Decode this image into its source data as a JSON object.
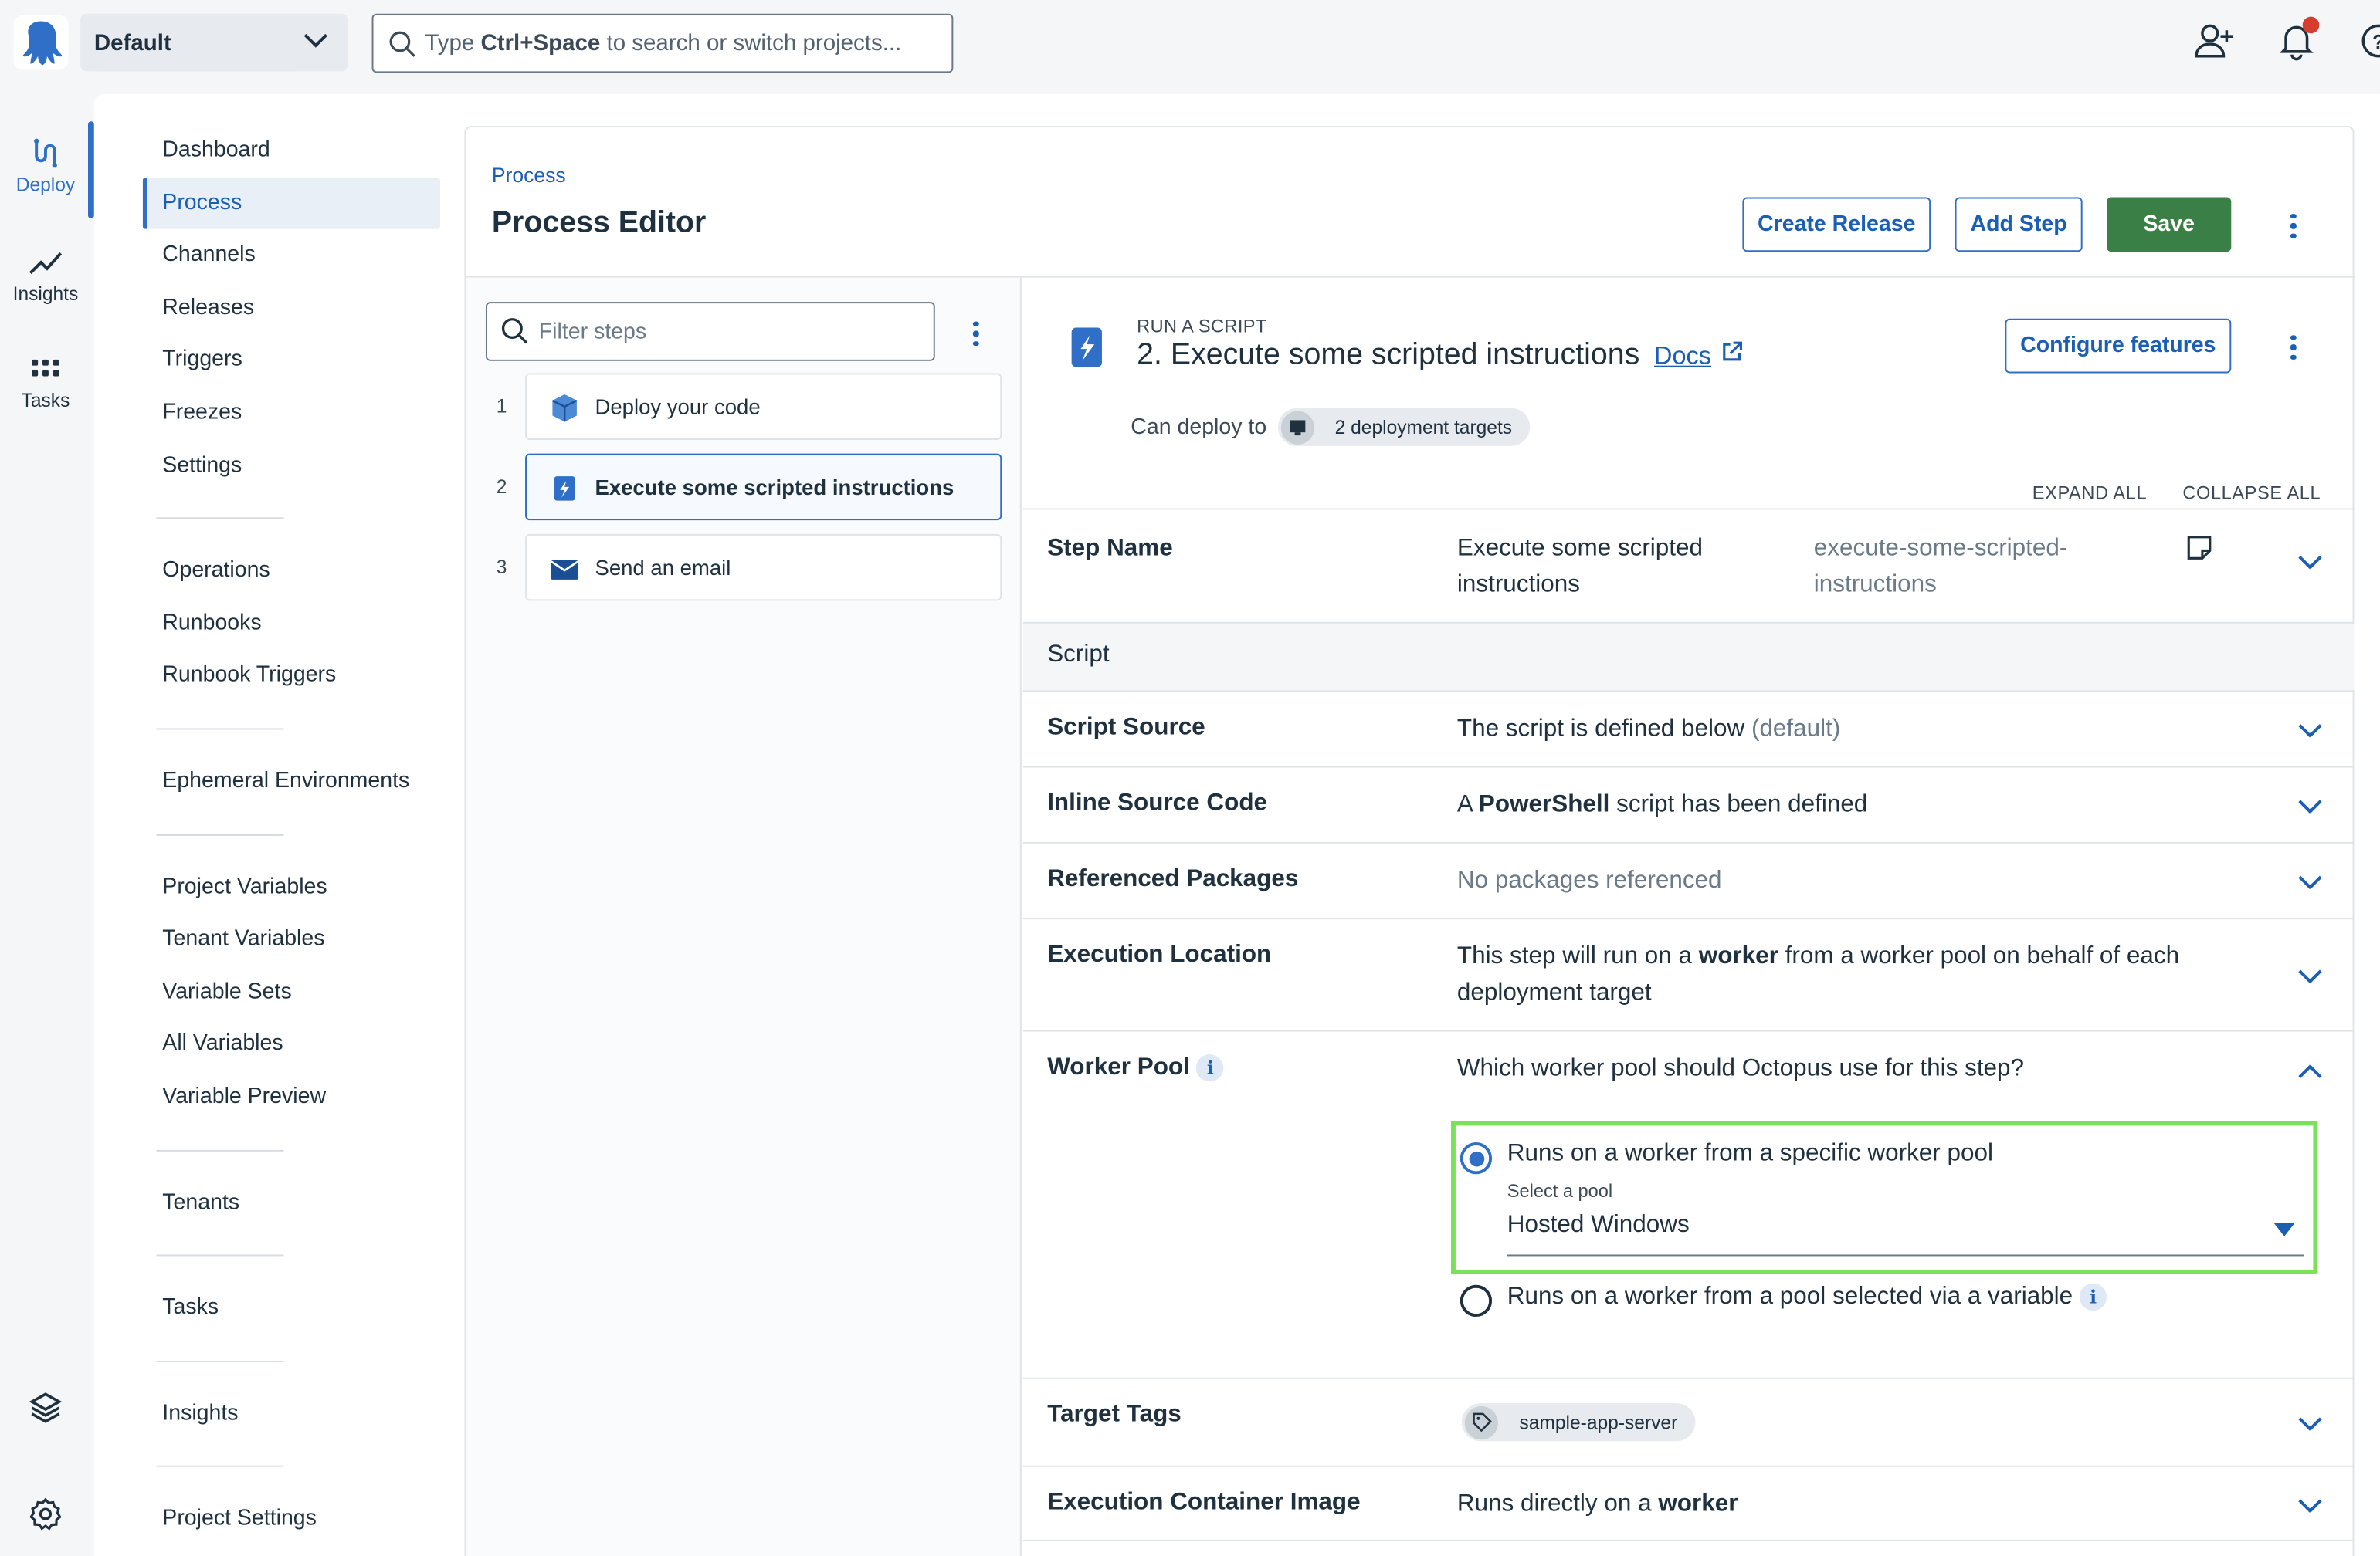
{
  "header": {
    "project": "Default",
    "search_prefix": "Type ",
    "search_shortcut": "Ctrl+Space",
    "search_suffix": " to search or switch projects..."
  },
  "rail": {
    "items": [
      {
        "label": "Deploy",
        "icon": "deploy-icon"
      },
      {
        "label": "Insights",
        "icon": "insights-icon"
      },
      {
        "label": "Tasks",
        "icon": "tasks-icon"
      }
    ]
  },
  "project_nav": {
    "groups": [
      [
        "Dashboard",
        "Process",
        "Channels",
        "Releases",
        "Triggers",
        "Freezes",
        "Settings"
      ],
      [
        "Operations",
        "Runbooks",
        "Runbook Triggers"
      ],
      [
        "Ephemeral Environments"
      ],
      [
        "Project Variables",
        "Tenant Variables",
        "Variable Sets",
        "All Variables",
        "Variable Preview"
      ],
      [
        "Tenants"
      ],
      [
        "Tasks"
      ],
      [
        "Insights"
      ],
      [
        "Project Settings"
      ]
    ],
    "active": "Process"
  },
  "page": {
    "breadcrumb": "Process",
    "title": "Process Editor",
    "create_release": "Create Release",
    "add_step": "Add Step",
    "save": "Save"
  },
  "steps": {
    "filter_placeholder": "Filter steps",
    "items": [
      {
        "num": "1",
        "label": "Deploy your code",
        "icon": "package-icon"
      },
      {
        "num": "2",
        "label": "Execute some scripted instructions",
        "icon": "script-icon"
      },
      {
        "num": "3",
        "label": "Send an email",
        "icon": "email-icon"
      }
    ]
  },
  "detail": {
    "type": "RUN A SCRIPT",
    "title": "2.  Execute some scripted instructions",
    "docs": "Docs",
    "configure": "Configure features",
    "can_deploy": "Can deploy to",
    "targets_chip": "2 deployment targets",
    "expand_all": "EXPAND ALL",
    "collapse_all": "COLLAPSE ALL",
    "step_name_label": "Step Name",
    "step_name_value": "Execute some scripted instructions",
    "step_slug": "execute-some-scripted-instructions",
    "script_section": "Script",
    "script_source_label": "Script Source",
    "script_source_value": "The script is defined below",
    "script_source_default": "(default)",
    "inline_label": "Inline Source Code",
    "inline_pre": "A ",
    "inline_bold": "PowerShell",
    "inline_post": " script has been defined",
    "packages_label": "Referenced Packages",
    "packages_value": "No packages referenced",
    "exec_loc_label": "Execution Location",
    "exec_loc_pre": "This step will run on a ",
    "exec_loc_bold": "worker",
    "exec_loc_post": " from a worker pool on behalf of each deployment target",
    "worker_pool_label": "Worker Pool",
    "worker_pool_question": "Which worker pool should Octopus use for this step?",
    "option_specific": "Runs on a worker from a specific worker pool",
    "select_pool_label": "Select a pool",
    "select_pool_value": "Hosted Windows",
    "option_variable": "Runs on a worker from a pool selected via a variable",
    "target_tags_label": "Target Tags",
    "target_tag": "sample-app-server",
    "container_label": "Execution Container Image",
    "container_pre": "Runs directly on a ",
    "container_bold": "worker"
  },
  "colors": {
    "accent": "#2f6fc7",
    "save": "#3a7f46",
    "highlight": "#7be05a",
    "notification": "#d63d2e"
  }
}
